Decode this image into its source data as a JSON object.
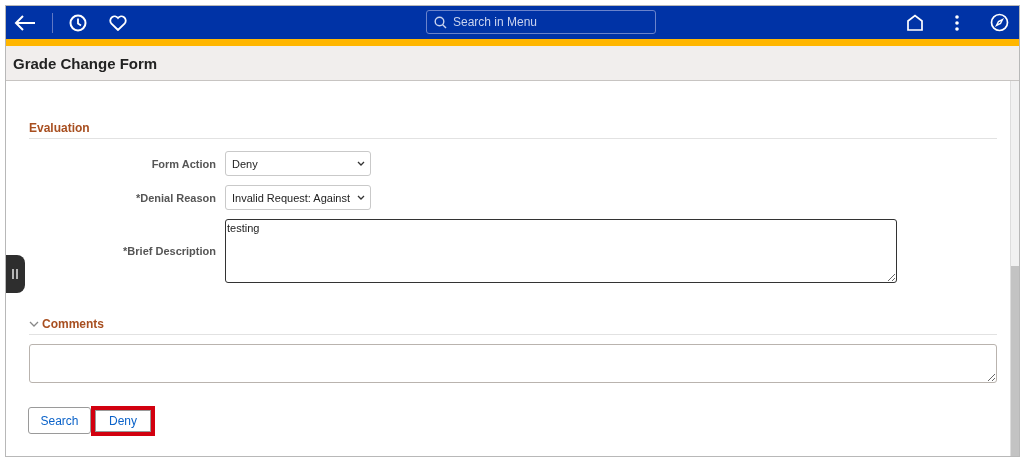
{
  "header": {
    "search": {
      "placeholder": "Search in Menu"
    }
  },
  "page_title": "Grade Change Form",
  "evaluation": {
    "title": "Evaluation",
    "fields": [
      {
        "kind": "select",
        "label": "Form Action",
        "value": "Deny"
      },
      {
        "kind": "select",
        "label": "*Denial Reason",
        "value": "Invalid Request: Against"
      },
      {
        "kind": "textarea",
        "label": "*Brief Description",
        "value": "testing"
      }
    ]
  },
  "comments": {
    "title": "Comments",
    "expanded": true
  },
  "buttons": [
    {
      "label": "Search",
      "highlighted": false
    },
    {
      "label": "Deny",
      "highlighted": true
    }
  ]
}
